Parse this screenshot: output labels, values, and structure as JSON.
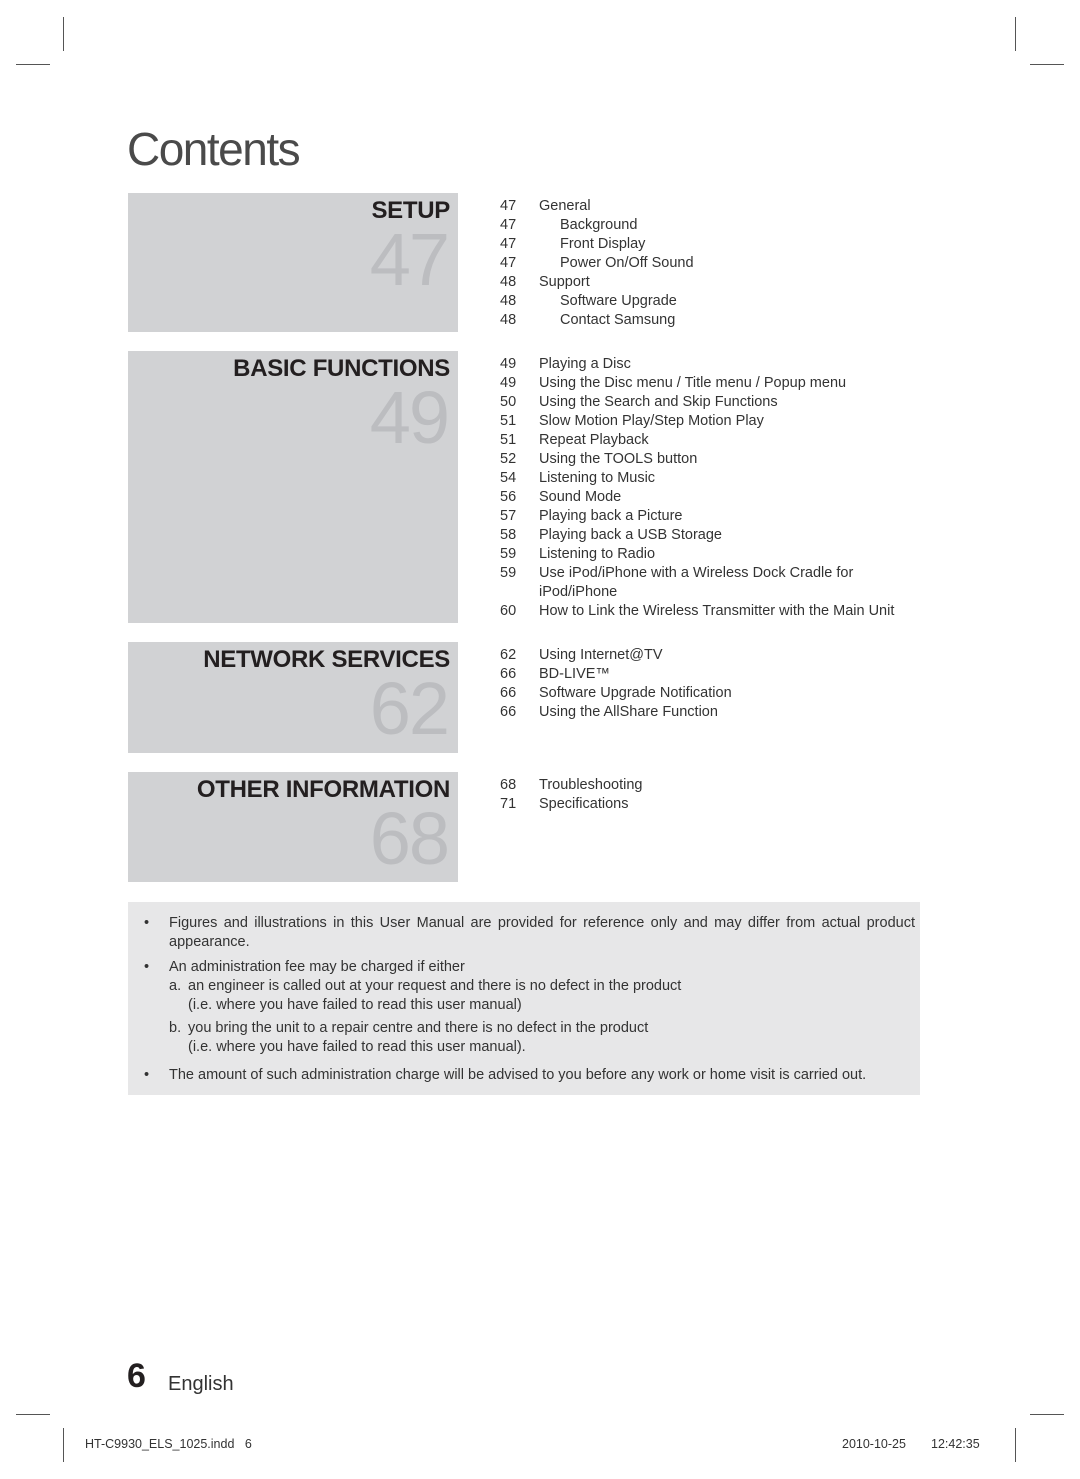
{
  "page_title": "Contents",
  "sections": [
    {
      "heading": "SETUP",
      "page": "47",
      "entries": [
        {
          "page": "47",
          "text": "General",
          "level": 1
        },
        {
          "page": "47",
          "text": "Background",
          "level": 2
        },
        {
          "page": "47",
          "text": "Front Display",
          "level": 2
        },
        {
          "page": "47",
          "text": "Power On/Off Sound",
          "level": 2
        },
        {
          "page": "48",
          "text": "Support",
          "level": 1
        },
        {
          "page": "48",
          "text": "Software Upgrade",
          "level": 2
        },
        {
          "page": "48",
          "text": "Contact Samsung",
          "level": 2
        }
      ]
    },
    {
      "heading": "BASIC FUNCTIONS",
      "page": "49",
      "entries": [
        {
          "page": "49",
          "text": "Playing a Disc",
          "level": 1
        },
        {
          "page": "49",
          "text": "Using the Disc menu / Title menu / Popup menu",
          "level": 1
        },
        {
          "page": "50",
          "text": "Using the Search and Skip Functions",
          "level": 1
        },
        {
          "page": "51",
          "text": "Slow Motion Play/Step Motion Play",
          "level": 1
        },
        {
          "page": "51",
          "text": "Repeat Playback",
          "level": 1
        },
        {
          "page": "52",
          "text": "Using the TOOLS button",
          "level": 1
        },
        {
          "page": "54",
          "text": "Listening to Music",
          "level": 1
        },
        {
          "page": "56",
          "text": "Sound Mode",
          "level": 1
        },
        {
          "page": "57",
          "text": "Playing back a Picture",
          "level": 1
        },
        {
          "page": "58",
          "text": "Playing back a USB Storage",
          "level": 1
        },
        {
          "page": "59",
          "text": "Listening to Radio",
          "level": 1
        },
        {
          "page": "59",
          "text": "Use iPod/iPhone with a Wireless Dock Cradle for iPod/iPhone",
          "level": 1
        },
        {
          "page": "60",
          "text": "How to Link the Wireless Transmitter with the Main Unit",
          "level": 1
        }
      ]
    },
    {
      "heading": "NETWORK SERVICES",
      "page": "62",
      "entries": [
        {
          "page": "62",
          "text": "Using Internet@TV",
          "level": 1
        },
        {
          "page": "66",
          "text": "BD-LIVE™",
          "level": 1
        },
        {
          "page": "66",
          "text": "Software Upgrade Notification",
          "level": 1
        },
        {
          "page": "66",
          "text": "Using the AllShare Function",
          "level": 1
        }
      ]
    },
    {
      "heading": "OTHER INFORMATION",
      "page": "68",
      "entries": [
        {
          "page": "68",
          "text": "Troubleshooting",
          "level": 1
        },
        {
          "page": "71",
          "text": "Specifications",
          "level": 1
        }
      ]
    }
  ],
  "notes": {
    "bullet_glyph": "•",
    "items": [
      "Figures and illustrations in this User Manual are provided for reference only and may differ from actual product appearance.",
      "An administration fee may be charged if either",
      "The amount of such administration charge will be advised to you before any work or home visit is carried out."
    ],
    "sub_items": [
      {
        "marker": "a.",
        "text": "an engineer is called out at your request and there is no defect in the product",
        "detail": "(i.e. where you have failed to read this user manual)"
      },
      {
        "marker": "b.",
        "text": "you bring the unit to a repair centre and there is no defect in the product",
        "detail": "(i.e. where you have failed to read this user manual)."
      }
    ]
  },
  "footer": {
    "page_number": "6",
    "language": "English",
    "slug_file": "HT-C9930_ELS_1025.indd   6",
    "slug_date": "2010-10-25",
    "slug_time": "12:42:35"
  },
  "colors": {
    "panel_bg": "#d1d2d4",
    "panel_number": "#bcbdc0",
    "note_bg": "#e7e7e8",
    "heading": "#231f20"
  }
}
